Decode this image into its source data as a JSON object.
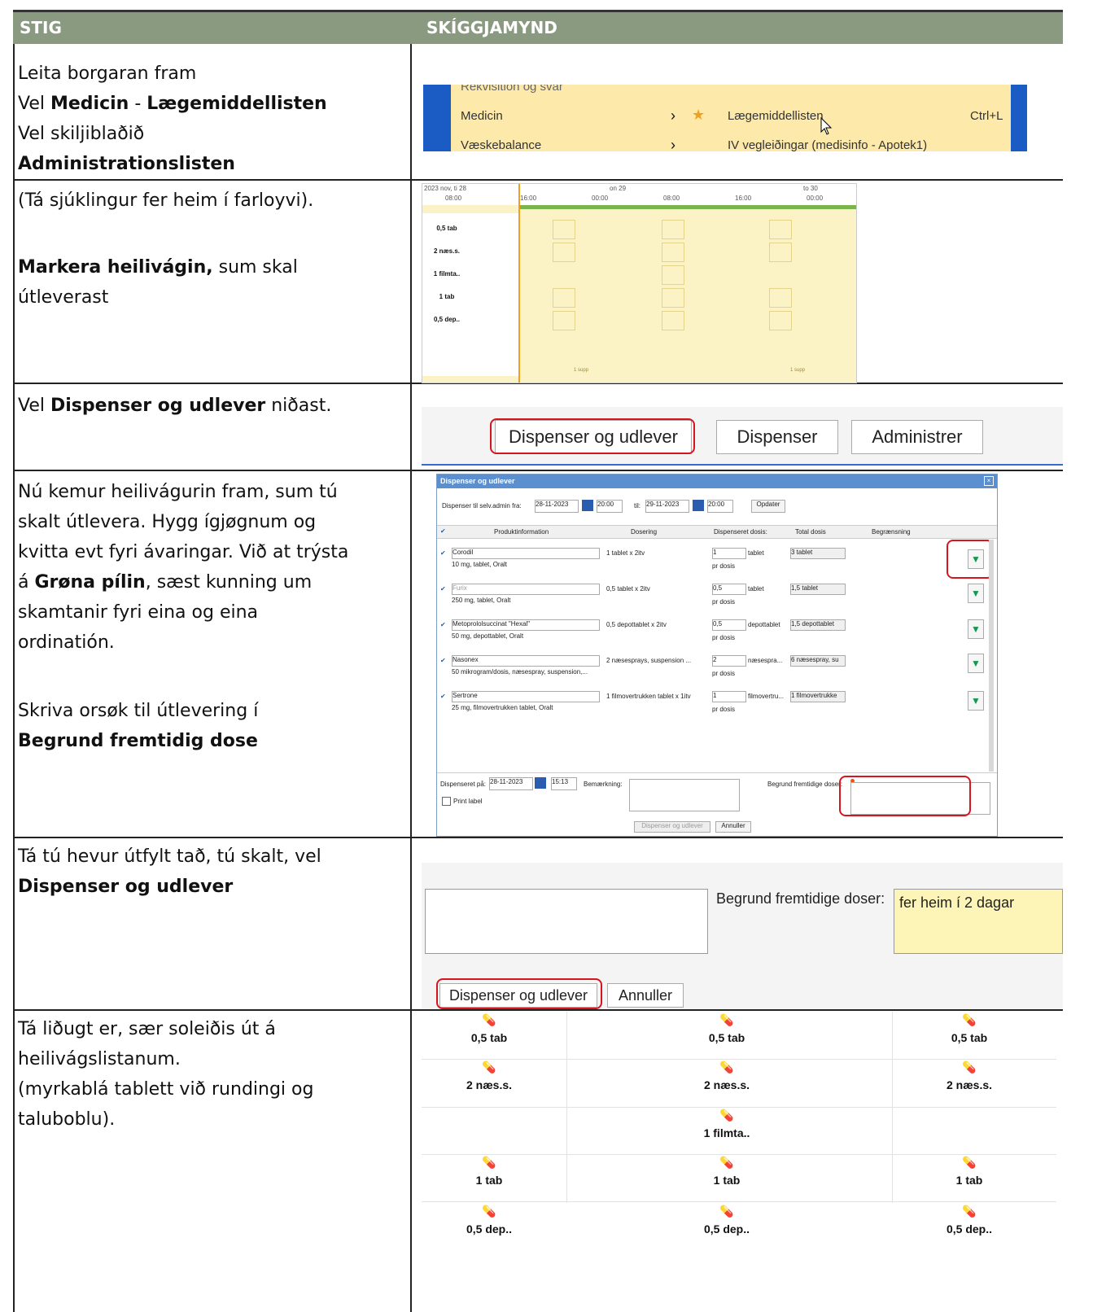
{
  "header": {
    "col_step": "STIG",
    "col_screenshot": "SKÍGGJAMYND"
  },
  "rows": [
    {
      "lines": [
        "Leita borgaran fram"
      ]
    },
    {
      "lines": [
        "(Tá sjúklingur fer heim í farloyvi)."
      ]
    }
  ],
  "step1": {
    "line1": "Leita borgaran fram",
    "line2_pre": "Vel ",
    "line2_b1": "Medicin",
    "line2_mid": " - ",
    "line2_b2": "Lægemiddellisten",
    "line3": "Vel skiljiblaðið",
    "line4": "Administrationslisten"
  },
  "step2": {
    "line1": "(Tá sjúklingur fer heim í farloyvi).",
    "bold": "Markera heilivágin,",
    "rest": " sum skal",
    "line3": "útleverast"
  },
  "step3": {
    "pre": "Vel ",
    "bold": "Dispenser og udlever",
    "post": " niðast."
  },
  "step4": {
    "l1": "Nú kemur heilivágurin fram, sum tú",
    "l2": "skalt útlevera. Hygg ígjøgnum og",
    "l3": "kvitta evt fyri ávaringar. Við at trýsta",
    "l4_pre": "á ",
    "l4_b": "Grøna pílin",
    "l4_post": ", sæst kunning um",
    "l5": "skamtanir fyri eina og eina",
    "l6": "ordinatión.",
    "l7": "Skriva orsøk til útlevering í",
    "l8": "Begrund fremtidig dose"
  },
  "step5": {
    "l1": "Tá tú hevur útfylt tað, tú skalt, vel",
    "l2": "Dispenser og udlever"
  },
  "step6": {
    "l1": "Tá liðugt er, sær soleiðis út á",
    "l2": "heilivágslistanum.",
    "l3": "(myrkablá tablett við rundingi og",
    "l4": "taluboblu)."
  },
  "shot1": {
    "item_top": "Rekvisition og svar",
    "item_medicin": "Medicin",
    "item_vaeske": "Væskebalance",
    "sub1": "Lægemiddellisten",
    "shortcut": "Ctrl+L",
    "sub2": "IV vegleiðingar (medisinfo - Apotek1)"
  },
  "shot2": {
    "date1": "2023 nov, ti 28",
    "date2": "on 29",
    "date3": "to 30",
    "times": [
      "08:00",
      "16:00",
      "00:00",
      "08:00",
      "16:00",
      "00:00"
    ],
    "labels": [
      "0,5 tab",
      "2 næs.s.",
      "1 filmta..",
      "1 tab",
      "0,5 dep.."
    ],
    "supp": "1 supp"
  },
  "shot3": {
    "btn1": "Dispenser og udlever",
    "btn2": "Dispenser",
    "btn3": "Administrer"
  },
  "shot4": {
    "title": "Dispenser og udlever",
    "from_label": "Dispenser til selv.admin fra:",
    "from_date": "28-11-2023",
    "from_time": "20:00",
    "to_label": "til:",
    "to_date": "29-11-2023",
    "to_time": "20:00",
    "update": "Opdater",
    "col_product": "Produktinformation",
    "col_dosing": "Dosering",
    "col_disp": "Dispenseret dosis:",
    "col_total": "Total dosis",
    "col_limit": "Begrænsning",
    "meds": [
      {
        "name": "Corodil",
        "desc": "10 mg, tablet, Oralt",
        "dose": "1 tablet x 2itv",
        "qty": "1",
        "unit": "tablet",
        "total": "3 tablet"
      },
      {
        "name": "Furix",
        "desc": "250 mg, tablet, Oralt",
        "dose": "0,5 tablet x 2itv",
        "qty": "0,5",
        "unit": "tablet",
        "total": "1,5 tablet"
      },
      {
        "name": "Metoprololsuccinat \"Hexal\"",
        "desc": "50 mg, depottablet, Oralt",
        "dose": "0,5 depottablet x 2itv",
        "qty": "0,5",
        "unit": "depottablet",
        "total": "1,5 depottablet"
      },
      {
        "name": "Nasonex",
        "desc": "50 mikrogram/dosis, næsespray, suspension,...",
        "dose": "2 næsesprays, suspension ...",
        "qty": "2",
        "unit": "næsespra...",
        "total": "6 næsespray, su"
      },
      {
        "name": "Sertrone",
        "desc": "25 mg, filmovertrukken tablet, Oralt",
        "dose": "1 filmovertrukken tablet x 1itv",
        "qty": "1",
        "unit": "filmovertru...",
        "total": "1 filmovertrukke"
      }
    ],
    "perdose": "pr dosis",
    "disp_on": "Dispenseret på:",
    "disp_date": "28-11-2023",
    "disp_time": "15:13",
    "remark": "Bemærkning:",
    "reason": "Begrund fremtidige doser:",
    "print": "Print label",
    "btn_ok": "Dispenser og udlever",
    "btn_cancel": "Annuller"
  },
  "shot5": {
    "reason_label": "Begrund fremtidige doser:",
    "reason_value": "fer heim í 2 dagar",
    "btn_ok": "Dispenser og udlever",
    "btn_cancel": "Annuller"
  },
  "shot6": {
    "labels": [
      "0,5 tab",
      "2 næs.s.",
      "1 filmta..",
      "1 tab",
      "0,5 dep.."
    ]
  },
  "colors": {
    "header_bg": "#8a9a80",
    "menu_blue": "#1a5bc4",
    "highlight": "#fde9a9",
    "red_outline": "#d4161e",
    "green_arrow": "#0e9a4f"
  }
}
